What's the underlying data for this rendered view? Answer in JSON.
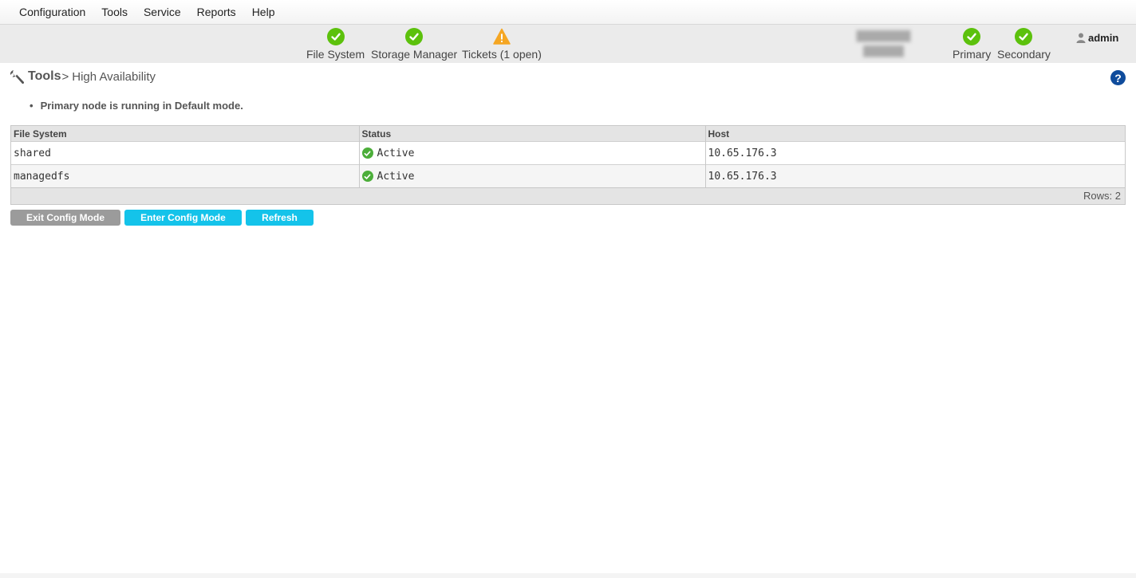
{
  "menu": [
    "Configuration",
    "Tools",
    "Service",
    "Reports",
    "Help"
  ],
  "status": {
    "file_system": "File System",
    "storage_manager": "Storage Manager",
    "tickets": "Tickets (1 open)",
    "primary": "Primary",
    "secondary": "Secondary",
    "user": "admin",
    "colors": {
      "ok": "#5cc10c",
      "warn": "#f5a623"
    }
  },
  "breadcrumb": {
    "root": "Tools",
    "separator": ">",
    "current": "High Availability"
  },
  "message": "Primary node is running in Default mode.",
  "table": {
    "headers": [
      "File System",
      "Status",
      "Host"
    ],
    "rows": [
      {
        "file_system": "shared",
        "status": "Active",
        "host": "10.65.176.3"
      },
      {
        "file_system": "managedfs",
        "status": "Active",
        "host": "10.65.176.3"
      }
    ],
    "footer": "Rows: 2"
  },
  "buttons": {
    "exit_config": "Exit Config Mode",
    "enter_config": "Enter Config Mode",
    "refresh": "Refresh"
  },
  "accent_color": "#14c3ea"
}
